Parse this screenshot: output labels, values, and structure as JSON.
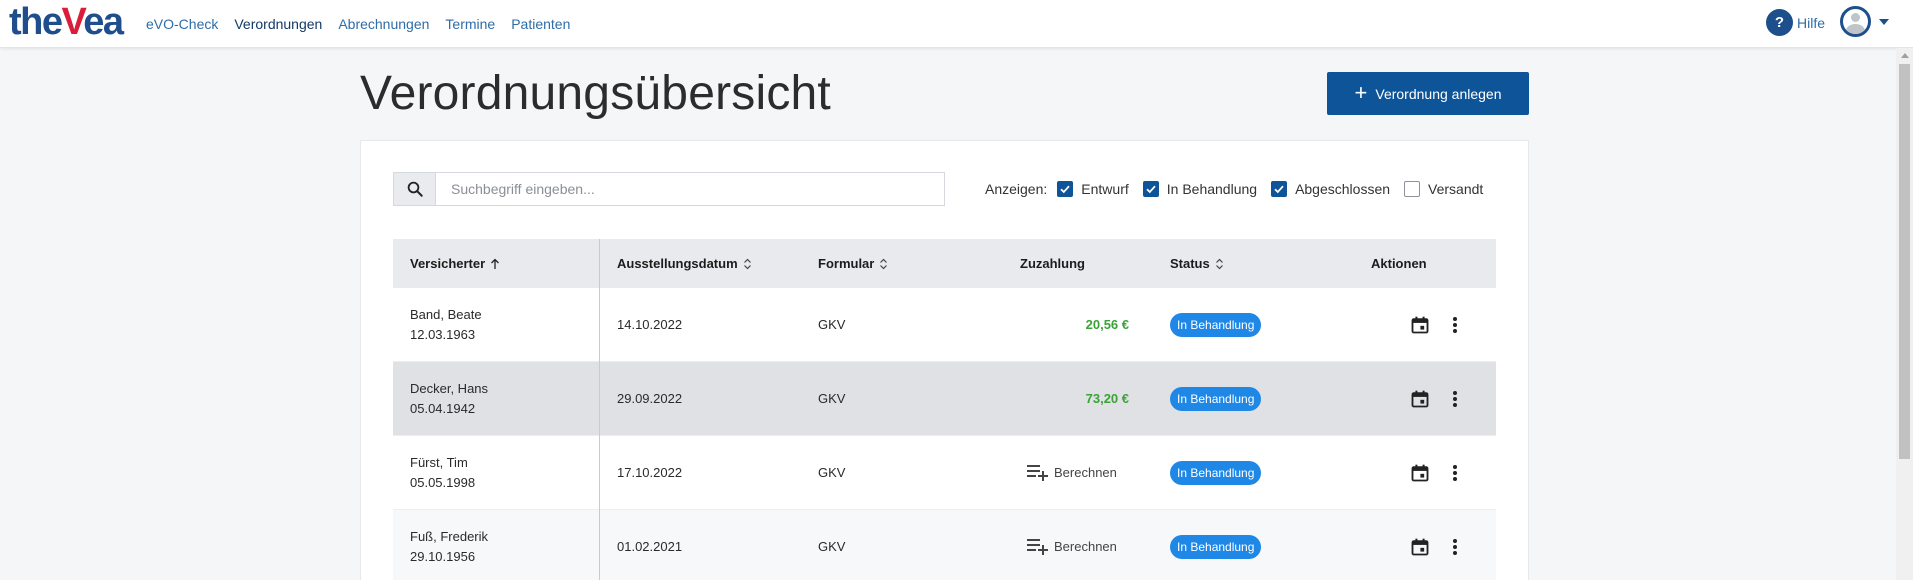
{
  "brand": {
    "logo_pre": "the",
    "logo_v": "V",
    "logo_post": "ea"
  },
  "nav": {
    "items": [
      {
        "label": "eVO-Check"
      },
      {
        "label": "Verordnungen",
        "active": true
      },
      {
        "label": "Abrechnungen"
      },
      {
        "label": "Termine"
      },
      {
        "label": "Patienten"
      }
    ],
    "help_label": "Hilfe",
    "help_glyph": "?"
  },
  "page": {
    "title": "Verordnungsübersicht",
    "new_button_label": "Verordnung anlegen"
  },
  "search": {
    "placeholder": "Suchbegriff eingeben...",
    "value": ""
  },
  "filters": {
    "label": "Anzeigen:",
    "options": [
      {
        "label": "Entwurf",
        "checked": true
      },
      {
        "label": "In Behandlung",
        "checked": true
      },
      {
        "label": "Abgeschlossen",
        "checked": true
      },
      {
        "label": "Versandt",
        "checked": false
      }
    ]
  },
  "table": {
    "columns": [
      "Versicherter",
      "Ausstellungsdatum",
      "Formular",
      "Zuzahlung",
      "Status",
      "Aktionen"
    ],
    "rows": [
      {
        "name": "Band, Beate",
        "birth": "12.03.1963",
        "date": "14.10.2022",
        "form": "GKV",
        "payment": "20,56 €",
        "status": "In Behandlung"
      },
      {
        "name": "Decker, Hans",
        "birth": "05.04.1942",
        "date": "29.09.2022",
        "form": "GKV",
        "payment": "73,20 €",
        "status": "In Behandlung"
      },
      {
        "name": "Fürst, Tim",
        "birth": "05.05.1998",
        "date": "17.10.2022",
        "form": "GKV",
        "payment": "Berechnen",
        "status": "In Behandlung"
      },
      {
        "name": "Fuß, Frederik",
        "birth": "29.10.1956",
        "date": "01.02.2021",
        "form": "GKV",
        "payment": "Berechnen",
        "status": "In Behandlung"
      }
    ]
  },
  "colors": {
    "primary": "#0e5498",
    "badge": "#1f87e6",
    "amount": "#3aa336",
    "nav_link": "#2e6da8"
  },
  "icons": [
    "search-icon",
    "plus-icon",
    "sort-asc-icon",
    "sort-icon",
    "calendar-icon",
    "more-vert-icon",
    "calculate-icon",
    "help-icon",
    "avatar-icon",
    "chevron-down-icon"
  ]
}
